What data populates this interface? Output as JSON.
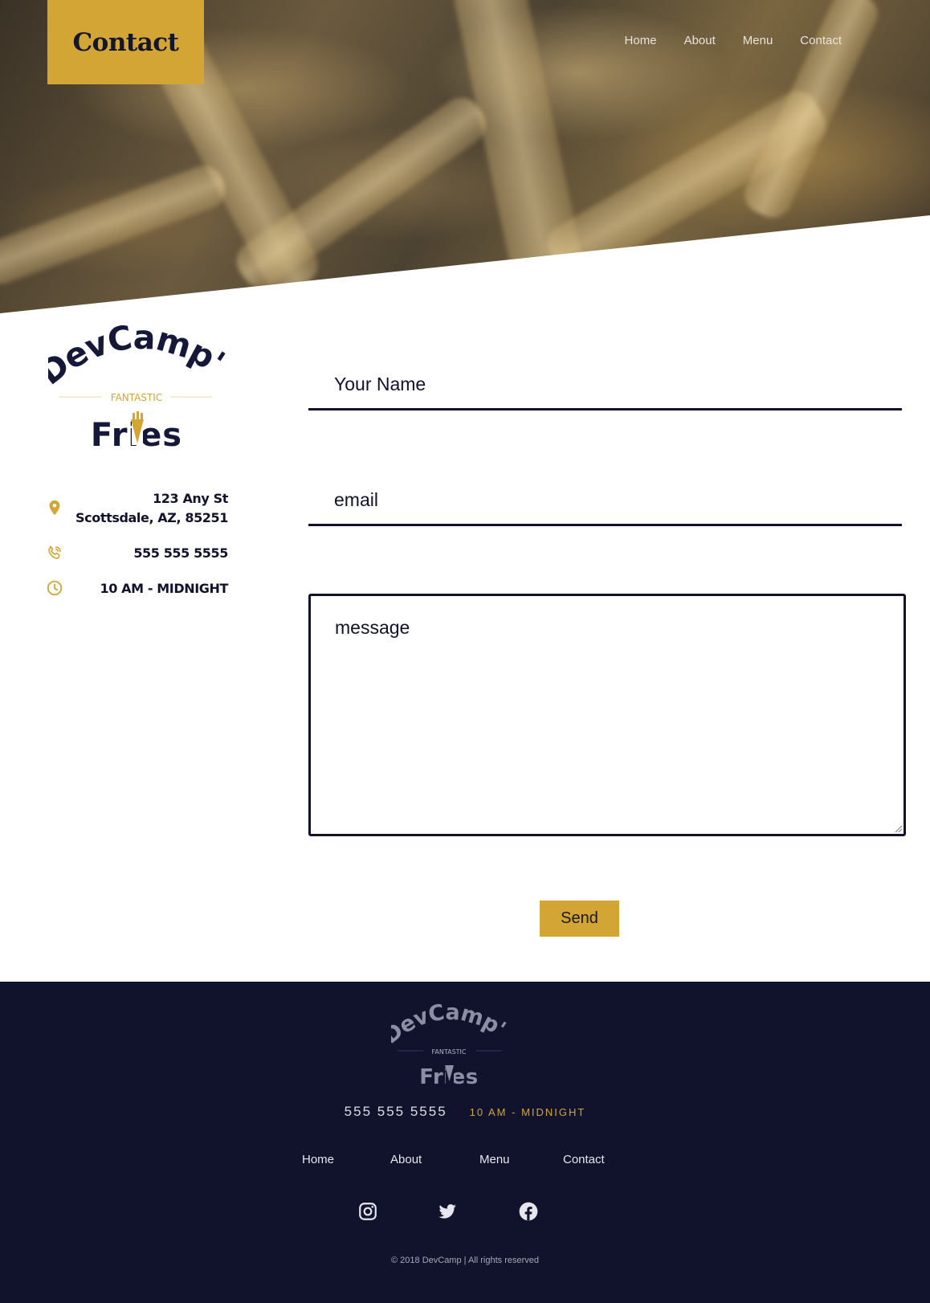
{
  "header": {
    "title": "Contact",
    "nav": [
      "Home",
      "About",
      "Menu",
      "Contact"
    ]
  },
  "logo": {
    "line1": "DevCamp's",
    "line2": "FANTASTIC",
    "line3": "Fries"
  },
  "info": {
    "address_line1": "123 Any St",
    "address_line2": "Scottsdale, AZ, 85251",
    "phone": "555 555 5555",
    "hours": "10 AM - MIDNIGHT",
    "icons": [
      "map-pin-icon",
      "phone-icon",
      "clock-icon"
    ]
  },
  "form": {
    "name_placeholder": "Your Name",
    "email_placeholder": "email",
    "message_placeholder": "message",
    "send_label": "Send"
  },
  "footer": {
    "phone": "555 555 5555",
    "hours": "10 AM - MIDNIGHT",
    "nav": [
      "Home",
      "About",
      "Menu",
      "Contact"
    ],
    "social_icons": [
      "instagram-icon",
      "twitter-icon",
      "facebook-icon"
    ],
    "copyright": "© 2018 DevCamp | All rights reserved"
  },
  "colors": {
    "accent": "#d3a535",
    "navy": "#11122c",
    "white": "#ffffff"
  }
}
